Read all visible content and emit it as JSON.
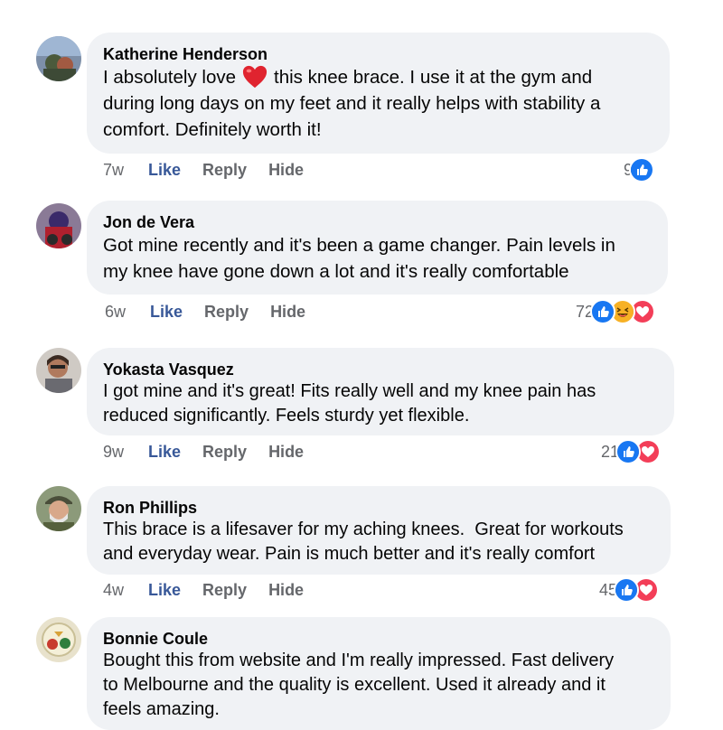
{
  "comments": [
    {
      "author": "Katherine Henderson",
      "text_before": "I absolutely love",
      "text_after": "this knee brace. I use it at the gym and\nduring long days on my feet and it really helps with stability a\ncomfort. Definitely worth it!",
      "time": "7w",
      "like": "Like",
      "reply": "Reply",
      "hide": "Hide",
      "count": "9",
      "reactions": [
        "like-icon"
      ]
    },
    {
      "author": "Jon de Vera",
      "text": "Got mine recently and it's been a game changer. Pain levels in\nmy knee have gone down a lot and it's really comfortable",
      "time": "6w",
      "like": "Like",
      "reply": "Reply",
      "hide": "Hide",
      "count": "72",
      "reactions": [
        "like-icon",
        "haha-icon",
        "love-icon"
      ]
    },
    {
      "author": "Yokasta Vasquez",
      "text": "I got mine and it's great! Fits really well and my knee pain has\nreduced significantly. Feels sturdy yet flexible.",
      "time": "9w",
      "like": "Like",
      "reply": "Reply",
      "hide": "Hide",
      "count": "21",
      "reactions": [
        "like-icon",
        "love-icon"
      ]
    },
    {
      "author": "Ron Phillips",
      "text": "This brace is a lifesaver for my aching knees.  Great for workouts\nand everyday wear. Pain is much better and it's really comfort",
      "time": "4w",
      "like": "Like",
      "reply": "Reply",
      "hide": "Hide",
      "count": "45",
      "reactions": [
        "like-icon",
        "love-icon"
      ]
    },
    {
      "author": "Bonnie Coule",
      "text": "Bought this from website and I'm really impressed. Fast delivery\nto Melbourne and the quality is excellent. Used it already and it\nfeels amazing."
    }
  ],
  "colors": {
    "bubble": "#f0f2f5",
    "like_blue": "#385898",
    "meta_gray": "#65676b",
    "reaction_blue": "#1877f2",
    "reaction_red": "#f33e58"
  }
}
